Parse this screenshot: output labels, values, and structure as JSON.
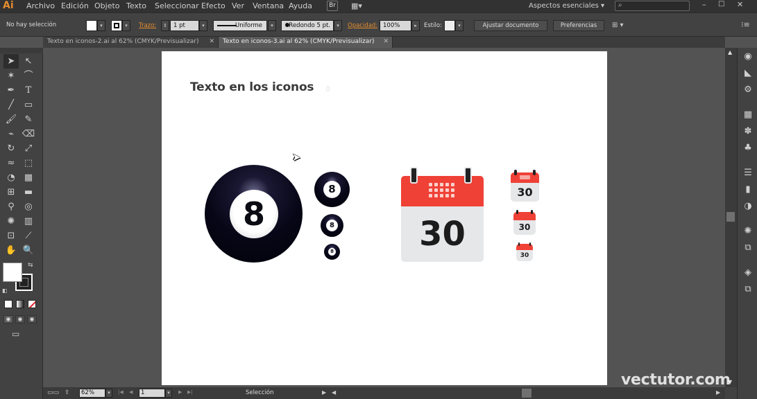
{
  "app": {
    "logo": "Ai"
  },
  "menubar": {
    "items": [
      "Archivo",
      "Edición",
      "Objeto",
      "Texto",
      "Seleccionar",
      "Efecto",
      "Ver",
      "Ventana",
      "Ayuda"
    ],
    "bridge": "Br",
    "workspace": "Aspectos esenciales",
    "search_placeholder": ""
  },
  "control_bar": {
    "selection_status": "No hay selección",
    "stroke_label": "Trazo:",
    "stroke_weight": "1 pt",
    "stroke_profile": "Uniforme",
    "brush": "Redondo 5 pt.",
    "opacity_label": "Opacidad:",
    "opacity_value": "100%",
    "style_label": "Estilo:",
    "adjust_button": "Ajustar documento",
    "prefs_button": "Preferencias"
  },
  "tabs": [
    {
      "label": "Texto en iconos-2.ai al 62% (CMYK/Previsualizar)",
      "active": false
    },
    {
      "label": "Texto en iconos-3.ai al 62% (CMYK/Previsualizar)",
      "active": true
    }
  ],
  "artboard": {
    "title": "Texto en los iconos",
    "ball_number": "8",
    "calendar_number": "30"
  },
  "status_bar": {
    "zoom": "62%",
    "artboard_number": "1",
    "tool": "Selección"
  },
  "watermark": "vectutor.com",
  "colors": {
    "accent_orange": "#e58c2e",
    "calendar_red": "#ef4136",
    "calendar_body": "#e6e7e9",
    "ball_black": "#070616"
  }
}
